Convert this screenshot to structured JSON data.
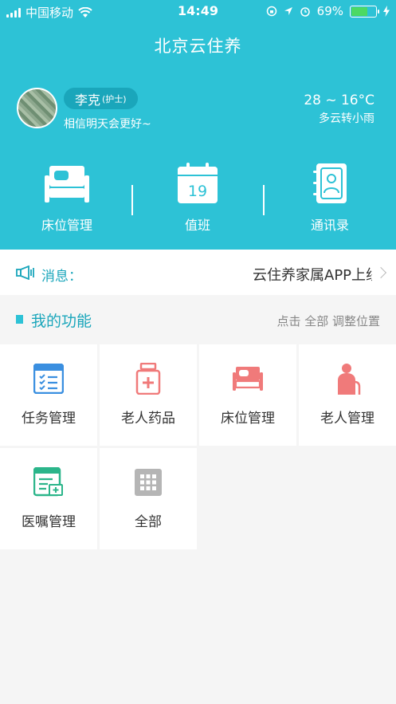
{
  "status_bar": {
    "carrier": "中国移动",
    "time": "14:49",
    "battery_percent": "69%",
    "battery_level": 0.69
  },
  "app": {
    "title": "北京云住养"
  },
  "user": {
    "name": "李克",
    "role": "(护士)",
    "motto": "相信明天会更好~"
  },
  "weather": {
    "temperature": "28 ~ 16°C",
    "condition": "多云转小雨"
  },
  "quick_actions": [
    {
      "label": "床位管理",
      "icon": "bed-icon"
    },
    {
      "label": "值班",
      "icon": "calendar-icon",
      "day": "19"
    },
    {
      "label": "通讯录",
      "icon": "contacts-book-icon"
    }
  ],
  "message": {
    "label": "消息：",
    "text": "云住养家属APP上线了",
    "icon": "megaphone-icon"
  },
  "functions": {
    "title": "我的功能",
    "hint": "点击 全部 调整位置",
    "items": [
      {
        "label": "任务管理",
        "icon": "task-list-icon"
      },
      {
        "label": "老人药品",
        "icon": "medicine-bottle-icon"
      },
      {
        "label": "床位管理",
        "icon": "bed-icon"
      },
      {
        "label": "老人管理",
        "icon": "elderly-person-icon"
      },
      {
        "label": "医嘱管理",
        "icon": "medical-order-icon"
      },
      {
        "label": "全部",
        "icon": "grid-icon"
      }
    ]
  },
  "colors": {
    "primary": "#2dc2d6",
    "pill": "#1aa6bb",
    "blue_icon": "#3a8fe0",
    "red_icon": "#f07a7a",
    "green_icon": "#2bb58a",
    "gray_icon": "#b5b5b5"
  }
}
